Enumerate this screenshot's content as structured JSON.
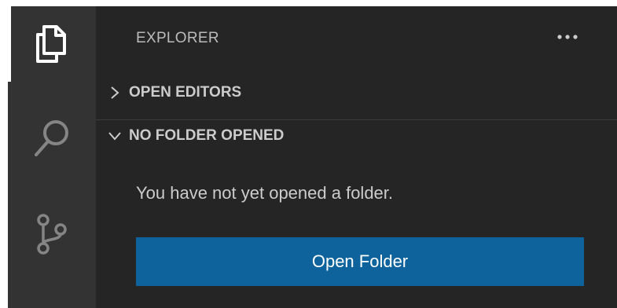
{
  "activity_bar": {
    "items": [
      {
        "name": "explorer",
        "icon": "files-icon",
        "active": true
      },
      {
        "name": "search",
        "icon": "search-icon",
        "active": false
      },
      {
        "name": "source-control",
        "icon": "source-control-icon",
        "active": false
      }
    ]
  },
  "sidebar": {
    "title": "EXPLORER",
    "more_actions_icon": "ellipsis-icon",
    "sections": [
      {
        "label": "OPEN EDITORS",
        "expanded": false
      },
      {
        "label": "NO FOLDER OPENED",
        "expanded": true
      }
    ],
    "empty_message": "You have not yet opened a folder.",
    "open_folder_label": "Open Folder"
  },
  "colors": {
    "activity_bar_bg": "#333333",
    "sidebar_bg": "#252526",
    "button_bg": "#0e639c",
    "text": "#cccccc",
    "button_text": "#ffffff"
  }
}
